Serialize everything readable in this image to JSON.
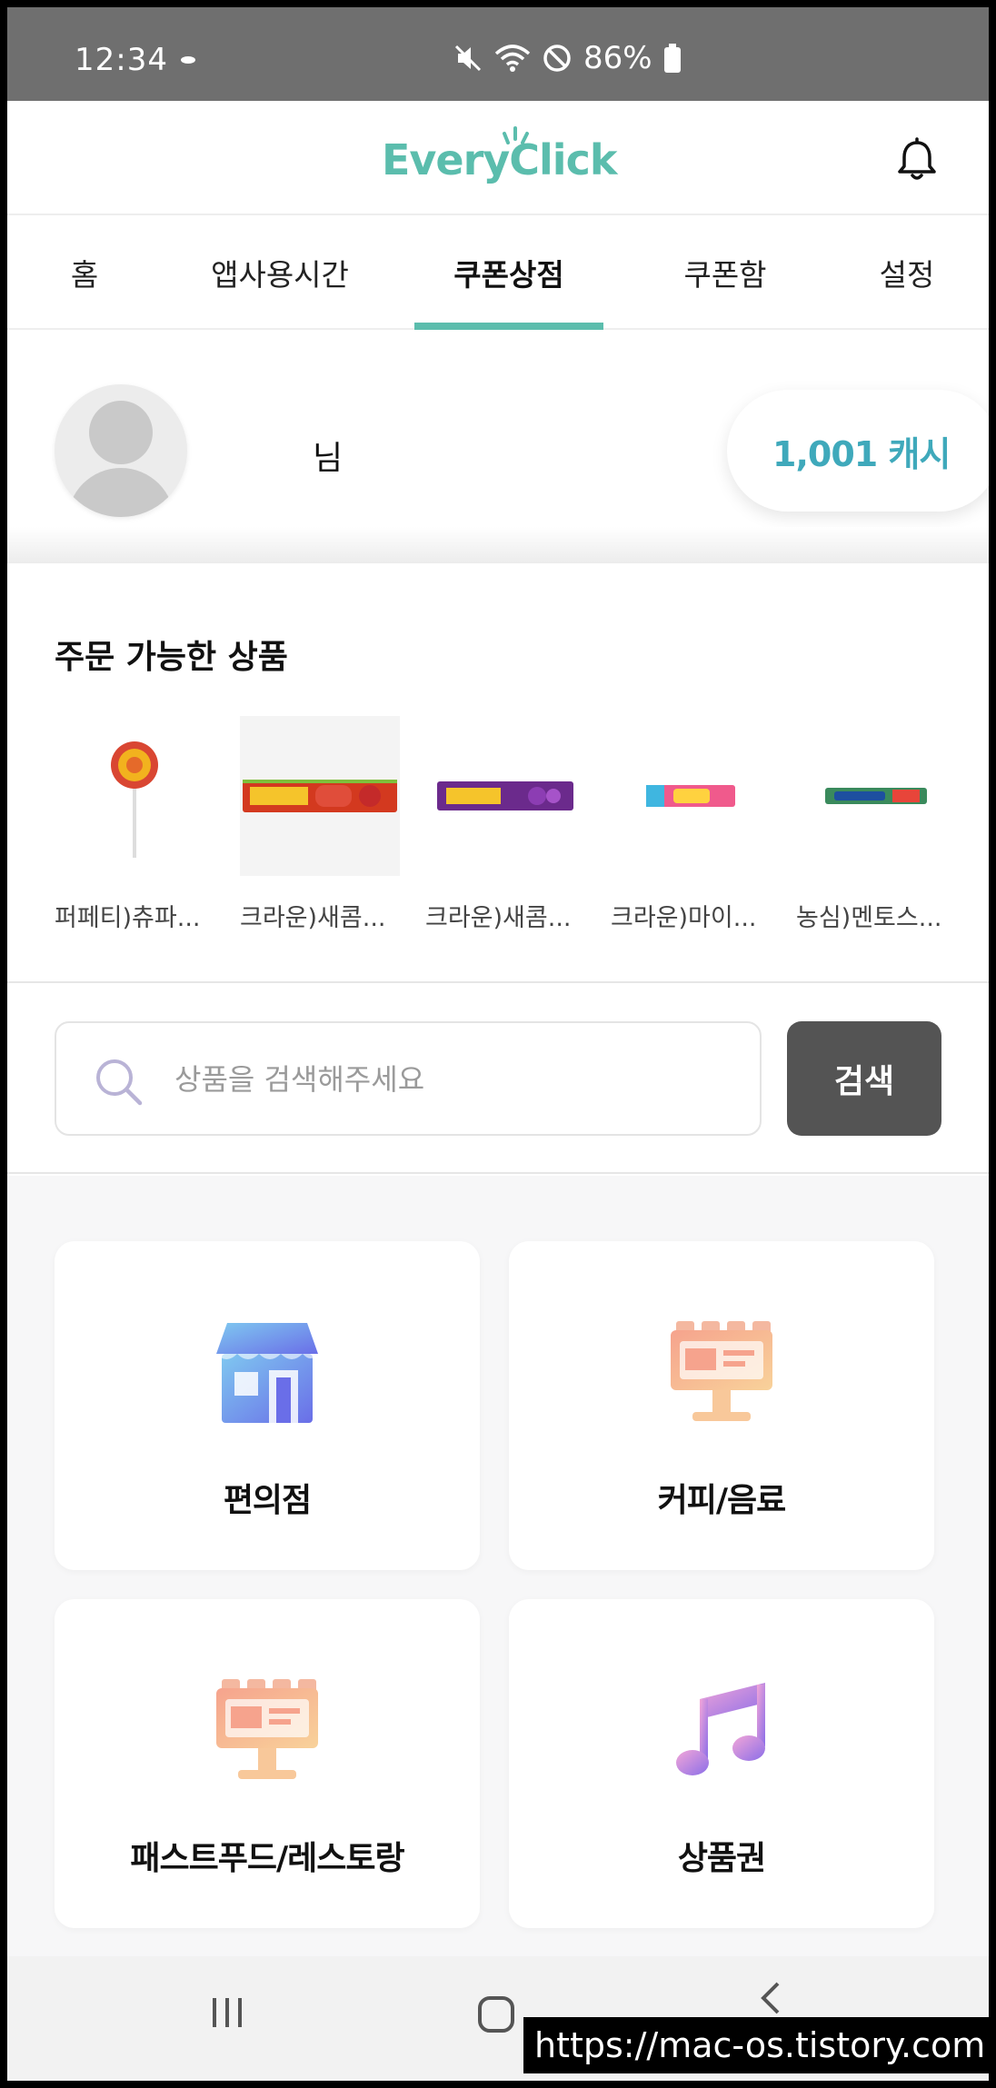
{
  "status_bar": {
    "time": "12:34",
    "battery": "86%"
  },
  "header": {
    "logo": "EveryClick",
    "accent_color": "#5bbdad"
  },
  "tabs": [
    {
      "label": "홈"
    },
    {
      "label": "앱사용시간"
    },
    {
      "label": "쿠폰상점",
      "active": true
    },
    {
      "label": "쿠폰함"
    },
    {
      "label": "설정"
    }
  ],
  "profile": {
    "name_suffix": "님",
    "cash": "1,001 캐시"
  },
  "products": {
    "title": "주문 가능한 상품",
    "items": [
      {
        "name": "퍼페티)츄파...",
        "icon": "lollipop-icon"
      },
      {
        "name": "크라운)새콤...",
        "icon": "candy-strawberry-icon"
      },
      {
        "name": "크라운)새콤...",
        "icon": "candy-grape-icon"
      },
      {
        "name": "크라운)마이...",
        "icon": "candy-mychew-icon"
      },
      {
        "name": "농심)멘토스...",
        "icon": "candy-mentos-icon"
      }
    ]
  },
  "search": {
    "placeholder": "상품을 검색해주세요",
    "button": "검색"
  },
  "categories": [
    {
      "label": "편의점",
      "icon": "store-icon"
    },
    {
      "label": "커피/음료",
      "icon": "billboard-icon"
    },
    {
      "label": "패스트푸드/레스토랑",
      "icon": "billboard-icon"
    },
    {
      "label": "상품권",
      "icon": "music-note-icon"
    }
  ],
  "nav_bar": {
    "watermark": "https://mac-os.tistory.com"
  }
}
